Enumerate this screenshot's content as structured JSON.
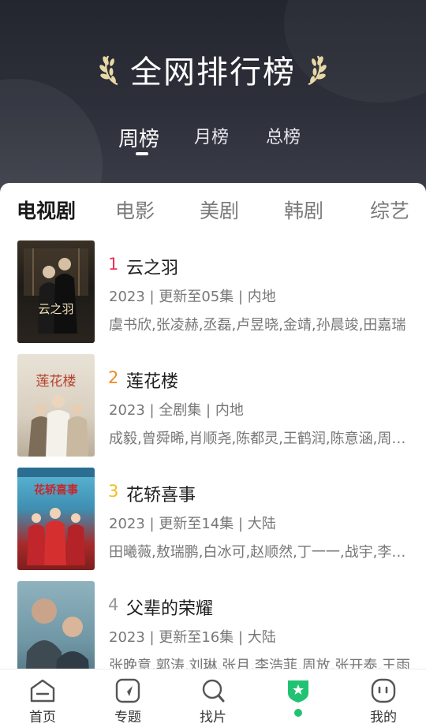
{
  "colors": {
    "rank_1": "#e8315a",
    "rank_2": "#f08a24",
    "rank_3": "#f3bd20",
    "rank_4": "#9a9a9a",
    "accent_green": "#21c373"
  },
  "header": {
    "title": "全网排行榜",
    "left_ornament_icon": "laurel-left-icon",
    "right_ornament_icon": "laurel-right-icon",
    "period_tabs": [
      {
        "label": "周榜",
        "active": true
      },
      {
        "label": "月榜",
        "active": false
      },
      {
        "label": "总榜",
        "active": false
      }
    ]
  },
  "category_tabs": [
    {
      "label": "电视剧",
      "active": true
    },
    {
      "label": "电影",
      "active": false
    },
    {
      "label": "美剧",
      "active": false
    },
    {
      "label": "韩剧",
      "active": false
    },
    {
      "label": "综艺",
      "active": false
    }
  ],
  "rankings": [
    {
      "rank": "1",
      "title": "云之羽",
      "meta": "2023 | 更新至05集 | 内地",
      "cast": "虞书欣,张凌赫,丞磊,卢昱晓,金靖,孙晨竣,田嘉瑞",
      "poster_caption": "云之羽"
    },
    {
      "rank": "2",
      "title": "莲花楼",
      "meta": "2023 | 全剧集 | 内地",
      "cast": "成毅,曾舜晞,肖顺尧,陈都灵,王鹤润,陈意涵,周依然",
      "poster_caption": "莲花楼"
    },
    {
      "rank": "3",
      "title": "花轿喜事",
      "meta": "2023 | 更新至14集 | 大陆",
      "cast": "田曦薇,敖瑞鹏,白冰可,赵顺然,丁一一,战宇,李昀锐",
      "poster_caption": "花轿喜事"
    },
    {
      "rank": "4",
      "title": "父辈的荣耀",
      "meta": "2023 | 更新至16集 | 大陆",
      "cast": "张晚意,郭涛,刘琳,张月,李浩菲,周放,张开泰,王雨",
      "poster_caption": ""
    }
  ],
  "bottom_nav": [
    {
      "label": "首页",
      "icon": "home-icon"
    },
    {
      "label": "专题",
      "icon": "compass-icon"
    },
    {
      "label": "找片",
      "icon": "search-icon"
    },
    {
      "label": "",
      "icon": "ranking-badge-icon",
      "active": true
    },
    {
      "label": "我的",
      "icon": "profile-icon"
    }
  ]
}
